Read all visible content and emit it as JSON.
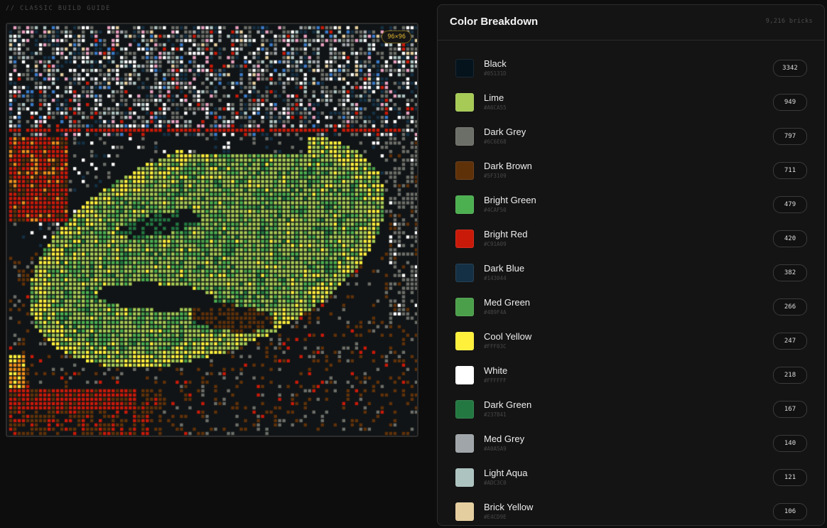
{
  "guide_label": "// CLASSIC BUILD GUIDE",
  "mosaic": {
    "size_label": "96×96",
    "grid": 96
  },
  "panel": {
    "title": "Color Breakdown",
    "total_label": "9,216 bricks",
    "colors": [
      {
        "name": "Black",
        "hex": "#05131D",
        "count": "3342"
      },
      {
        "name": "Lime",
        "hex": "#A6CA55",
        "count": "949"
      },
      {
        "name": "Dark Grey",
        "hex": "#6C6E68",
        "count": "797"
      },
      {
        "name": "Dark Brown",
        "hex": "#5F3109",
        "count": "711"
      },
      {
        "name": "Bright Green",
        "hex": "#4CAF50",
        "count": "479"
      },
      {
        "name": "Bright Red",
        "hex": "#C91A09",
        "count": "420"
      },
      {
        "name": "Dark Blue",
        "hex": "#143044",
        "count": "382"
      },
      {
        "name": "Med Green",
        "hex": "#4B9F4A",
        "count": "266"
      },
      {
        "name": "Cool Yellow",
        "hex": "#FFF03C",
        "count": "247"
      },
      {
        "name": "White",
        "hex": "#FFFFFF",
        "count": "218"
      },
      {
        "name": "Dark Green",
        "hex": "#237841",
        "count": "167"
      },
      {
        "name": "Med Grey",
        "hex": "#A0A5A9",
        "count": "140"
      },
      {
        "name": "Light Aqua",
        "hex": "#ADC3C0",
        "count": "121"
      },
      {
        "name": "Brick Yellow",
        "hex": "#E4CD9E",
        "count": "106"
      }
    ]
  }
}
